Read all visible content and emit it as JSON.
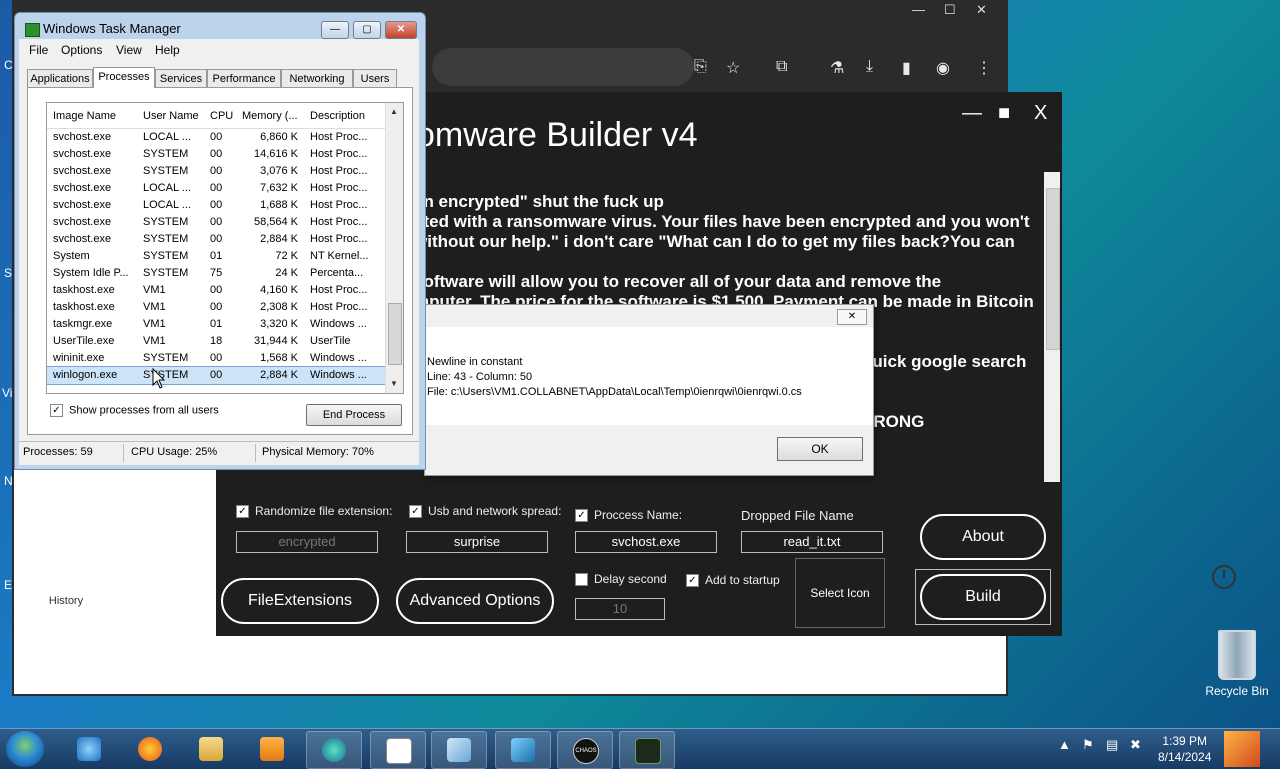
{
  "desktop": {
    "fragments": [
      "Vi",
      "S",
      "N",
      "E",
      "C"
    ],
    "recycle_bin_label": "Recycle Bin"
  },
  "browser": {
    "controls": [
      "—",
      "☐",
      "✕"
    ],
    "history_label": "History"
  },
  "builder": {
    "title": "omware Builder v4",
    "window_controls": [
      "—",
      "■",
      "X"
    ],
    "note_lines": [
      "en encrypted\" shut the fuck up",
      "cted with a ransomware virus. Your files have been encrypted and you won't",
      "without our help.\" i don't care \"What can I do to get my files back?You can",
      "",
      " software will allow you to recover all of your data and remove the",
      "mputer. The price for the software is $1,500. Payment can be made in Bitcoin",
      "",
      "quick google search",
      "",
      "VRONG"
    ],
    "options": {
      "randomize_ext": {
        "label": "Randomize file extension:",
        "checked": true,
        "value": "encrypted"
      },
      "usb_spread": {
        "label": "Usb and network spread:",
        "checked": true,
        "value": "surprise"
      },
      "process_name": {
        "label": "Proccess Name:",
        "checked": true,
        "value": "svchost.exe"
      },
      "dropped_file": {
        "label": "Dropped File Name",
        "value": "read_it.txt"
      },
      "delay": {
        "label": "Delay second",
        "checked": false,
        "value": "10"
      },
      "startup": {
        "label": "Add to startup",
        "checked": true
      }
    },
    "buttons": {
      "file_extensions": "FileExtensions",
      "advanced_options": "Advanced Options",
      "select_icon": "Select Icon",
      "about": "About",
      "build": "Build"
    }
  },
  "error_dialog": {
    "close_glyph": "✕",
    "line1": "Newline in constant",
    "line2": "Line: 43 - Column: 50",
    "line3": "File: c:\\Users\\VM1.COLLABNET\\AppData\\Local\\Temp\\0ienrqwi\\0ienrqwi.0.cs",
    "ok_label": "OK"
  },
  "task_manager": {
    "title": "Windows Task Manager",
    "menu": [
      "File",
      "Options",
      "View",
      "Help"
    ],
    "tabs": [
      "Applications",
      "Processes",
      "Services",
      "Performance",
      "Networking",
      "Users"
    ],
    "active_tab": "Processes",
    "columns": [
      "Image Name",
      "User Name",
      "CPU",
      "Memory (...",
      "Description"
    ],
    "rows": [
      [
        "svchost.exe",
        "LOCAL ...",
        "00",
        "6,860 K",
        "Host Proc..."
      ],
      [
        "svchost.exe",
        "SYSTEM",
        "00",
        "14,616 K",
        "Host Proc..."
      ],
      [
        "svchost.exe",
        "SYSTEM",
        "00",
        "3,076 K",
        "Host Proc..."
      ],
      [
        "svchost.exe",
        "LOCAL ...",
        "00",
        "7,632 K",
        "Host Proc..."
      ],
      [
        "svchost.exe",
        "LOCAL ...",
        "00",
        "1,688 K",
        "Host Proc..."
      ],
      [
        "svchost.exe",
        "SYSTEM",
        "00",
        "58,564 K",
        "Host Proc..."
      ],
      [
        "svchost.exe",
        "SYSTEM",
        "00",
        "2,884 K",
        "Host Proc..."
      ],
      [
        "System",
        "SYSTEM",
        "01",
        "72 K",
        "NT Kernel..."
      ],
      [
        "System Idle P...",
        "SYSTEM",
        "75",
        "24 K",
        "Percenta..."
      ],
      [
        "taskhost.exe",
        "VM1",
        "00",
        "4,160 K",
        "Host Proc..."
      ],
      [
        "taskhost.exe",
        "VM1",
        "00",
        "2,308 K",
        "Host Proc..."
      ],
      [
        "taskmgr.exe",
        "VM1",
        "01",
        "3,320 K",
        "Windows ..."
      ],
      [
        "UserTile.exe",
        "VM1",
        "18",
        "31,944 K",
        "UserTile"
      ],
      [
        "wininit.exe",
        "SYSTEM",
        "00",
        "1,568 K",
        "Windows ..."
      ],
      [
        "winlogon.exe",
        "SYSTEM",
        "00",
        "2,884 K",
        "Windows ..."
      ]
    ],
    "selected_row": 14,
    "show_all_label": "Show processes from all users",
    "show_all_checked": true,
    "end_process_label": "End Process",
    "status": {
      "processes": "Processes: 59",
      "cpu": "CPU Usage: 25%",
      "memory": "Physical Memory: 70%"
    }
  },
  "taskbar": {
    "time": "1:39 PM",
    "date": "8/14/2024",
    "apps": [
      "internet-explorer",
      "firefox",
      "file-explorer",
      "media-player",
      "edge",
      "notepad",
      "paint",
      "network",
      "chaos-builder",
      "task-manager"
    ],
    "chaos_label": "CHAOS"
  }
}
